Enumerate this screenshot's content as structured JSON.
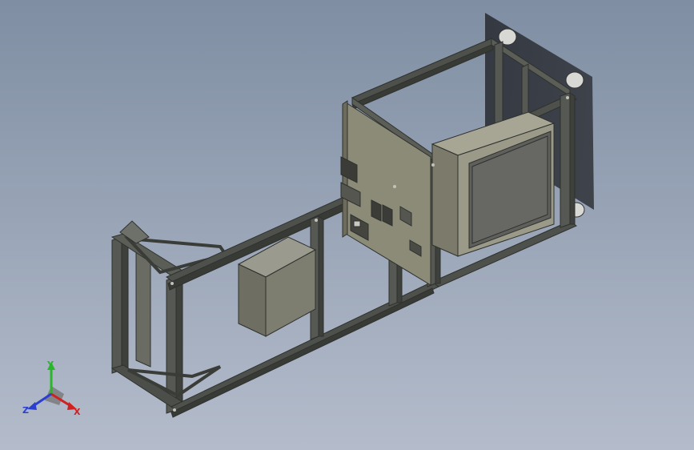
{
  "viewport": {
    "background_top": "#7f8ea3",
    "background_bottom": "#b4bccb"
  },
  "model": {
    "frame_color": "#4a4d48",
    "panel_color": "#8c8b78",
    "box_color": "#7e7e70",
    "screen_color": "#5f5f5b"
  },
  "triad": {
    "x_label": "X",
    "y_label": "Y",
    "z_label": "Z",
    "x_color": "#d0201f",
    "y_color": "#2bb52b",
    "z_color": "#2a3fd0"
  }
}
